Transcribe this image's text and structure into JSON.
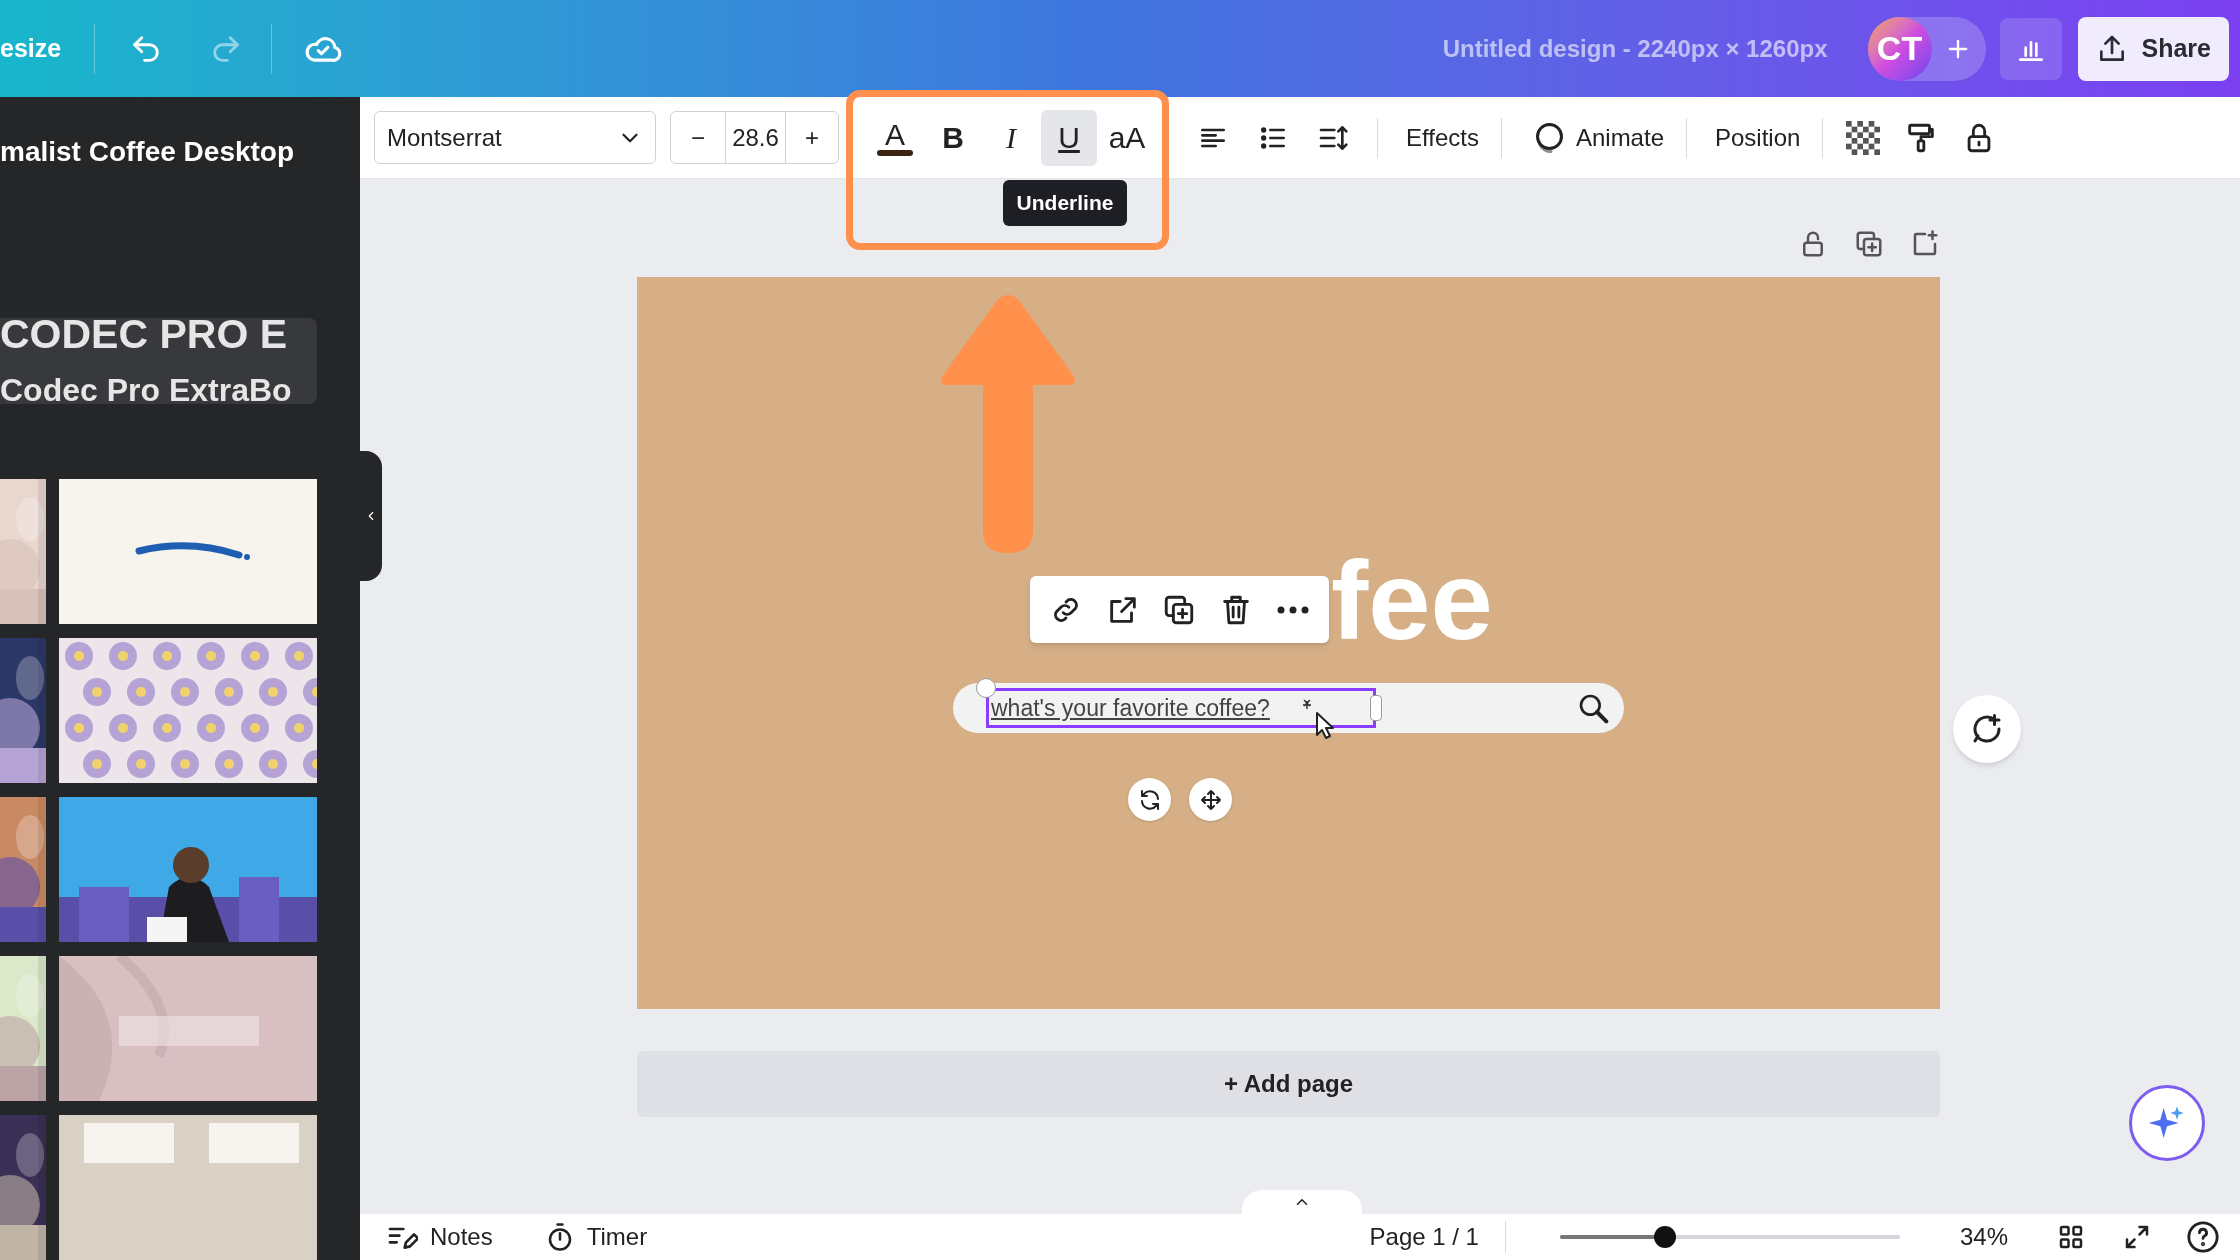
{
  "top_bar": {
    "resize_label": "esize",
    "title": "Untitled design - 2240px × 1260px",
    "avatar_initials": "CT",
    "share_label": "Share"
  },
  "sidebar": {
    "title": "malist Coffee Desktop",
    "font_card": {
      "line_1": "CODEC PRO E",
      "line_2": "Codec Pro ExtraBo"
    }
  },
  "text_toolbar": {
    "font": "Montserrat",
    "font_size": "28.6",
    "decrease": "−",
    "increase": "+",
    "format_buttons": [
      {
        "kind": "color",
        "label": "A",
        "color": "#3b2414"
      },
      {
        "kind": "bold",
        "label": "B",
        "selected": false
      },
      {
        "kind": "italic",
        "label": "I",
        "selected": false
      },
      {
        "kind": "underline",
        "label": "U",
        "selected": true
      },
      {
        "kind": "case",
        "label": "aA"
      }
    ],
    "tooltip": "Underline",
    "tools": [
      "Effects",
      "Animate",
      "Position"
    ]
  },
  "page": {
    "heading": "fee",
    "search_text": "what's your favorite coffee?"
  },
  "add_page": "+ Add page",
  "bottom_bar": {
    "notes": "Notes",
    "timer": "Timer",
    "page_indicator": "Page 1 / 1",
    "zoom": {
      "level": 0.31,
      "reading": "34%"
    }
  }
}
